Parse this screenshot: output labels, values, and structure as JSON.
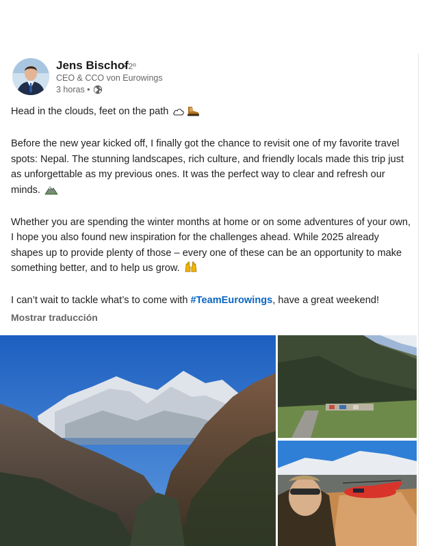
{
  "post": {
    "author": {
      "name": "Jens Bischof",
      "degree": "• 2º",
      "headline": "CEO & CCO von Eurowings",
      "time": "3 horas •",
      "visibility_icon": "globe-icon"
    },
    "paragraphs": {
      "p1": "Head in the clouds, feet on the path",
      "p2": "Before the new year kicked off, I finally got the chance to revisit one of my favorite travel spots: Nepal. The stunning landscapes, rich culture, and friendly locals made this trip just as unforgettable as my previous ones. It was the perfect way to clear and refresh our minds.",
      "p3": "Whether you are spending the winter months at home or on some adventures of your own, I hope you also found new inspiration for the challenges ahead. While 2025 already shapes up to provide plenty of those – every one of these can be an opportunity to make something better, and to help us grow.",
      "p4_before": "I can’t wait to tackle what’s to come with ",
      "p4_hashtag": "#TeamEurowings",
      "p4_after": ", have a great weekend!"
    },
    "emojis": [
      "cloud-emoji",
      "hiking-boot-emoji",
      "mountain-emoji",
      "raised-hands-emoji"
    ],
    "show_translation": "Mostrar traducción",
    "photos": [
      "mountain-everest-photo",
      "lukla-airstrip-photo",
      "helicopter-selfie-photo"
    ]
  },
  "colors": {
    "hashtag": "#0a66c2",
    "secondary_text": "#666666",
    "text": "#1f1f1f"
  }
}
